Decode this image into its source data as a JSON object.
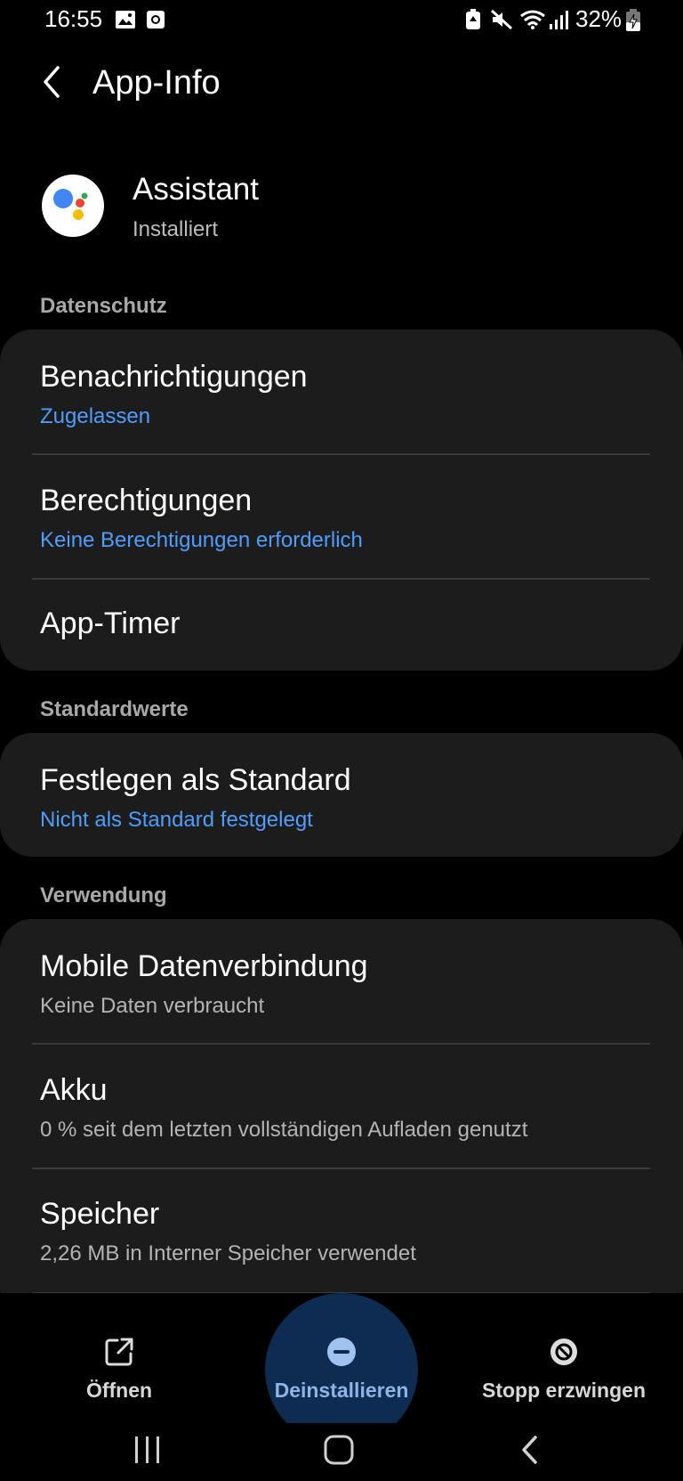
{
  "status_bar": {
    "time": "16:55",
    "battery": "32%",
    "icons": [
      "gallery-icon",
      "screenshot-icon",
      "battery-saver-icon",
      "mute-icon",
      "wifi-icon",
      "signal-icon",
      "battery-charging-icon"
    ]
  },
  "header": {
    "title": "App-Info"
  },
  "app": {
    "name": "Assistant",
    "status": "Installiert"
  },
  "sections": {
    "privacy": {
      "label": "Datenschutz",
      "items": [
        {
          "title": "Benachrichtigungen",
          "subtitle": "Zugelassen"
        },
        {
          "title": "Berechtigungen",
          "subtitle": "Keine Berechtigungen erforderlich"
        },
        {
          "title": "App-Timer",
          "subtitle": ""
        }
      ]
    },
    "defaults": {
      "label": "Standardwerte",
      "items": [
        {
          "title": "Festlegen als Standard",
          "subtitle": "Nicht als Standard festgelegt"
        }
      ]
    },
    "usage": {
      "label": "Verwendung",
      "items": [
        {
          "title": "Mobile Datenverbindung",
          "subtitle": "Keine Daten verbraucht"
        },
        {
          "title": "Akku",
          "subtitle": "0 % seit dem letzten vollständigen Aufladen genutzt"
        },
        {
          "title": "Speicher",
          "subtitle": "2,26 MB in Interner Speicher verwendet"
        }
      ]
    }
  },
  "actions": {
    "open": "Öffnen",
    "uninstall": "Deinstallieren",
    "force_stop": "Stopp erzwingen"
  },
  "colors": {
    "background": "#000000",
    "card": "#1c1c1c",
    "accent_blue": "#4f9dff",
    "pressed_highlight": "#0e2c52"
  }
}
